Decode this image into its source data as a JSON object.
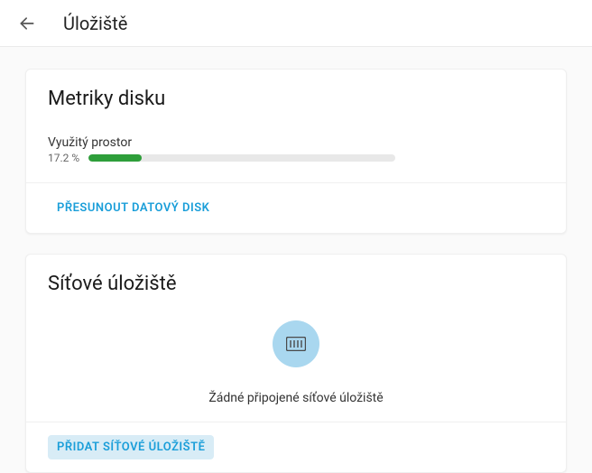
{
  "header": {
    "title": "Úložiště"
  },
  "disk_metrics": {
    "title": "Metriky disku",
    "used_space_label": "Využitý prostor",
    "used_percent_text": "17.2 %",
    "used_percent": 17.2,
    "move_button": "Přesunout datový disk"
  },
  "network_storage": {
    "title": "Síťové úložiště",
    "empty_text": "Žádné připojené síťové úložiště",
    "add_button": "Přidat síťové úložiště"
  }
}
